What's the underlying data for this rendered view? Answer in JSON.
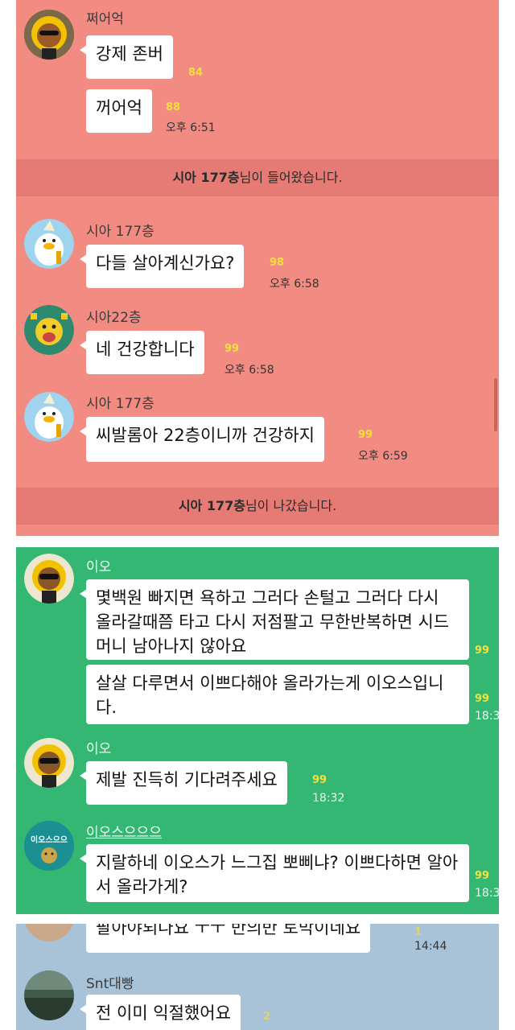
{
  "panel1": {
    "msg1": {
      "sender": "쩌어억",
      "bubbles": [
        {
          "text": "강제 존버",
          "unread": "84"
        },
        {
          "text": "꺼어억",
          "unread": "88",
          "time": "오후 6:51"
        }
      ]
    },
    "notice_join": {
      "name": "시아 177층",
      "suffix": "님이 들어왔습니다."
    },
    "msg2": {
      "sender": "시아 177층",
      "text": "다들 살아계신가요?",
      "unread": "98",
      "time": "오후 6:58"
    },
    "msg3": {
      "sender": "시아22층",
      "text": "네 건강합니다",
      "unread": "99",
      "time": "오후 6:58"
    },
    "msg4": {
      "sender": "시아 177층",
      "text": "씨발롬아 22층이니까 건강하지",
      "unread": "99",
      "time": "오후 6:59"
    },
    "notice_leave": {
      "name": "시아 177층",
      "suffix": "님이 나갔습니다."
    }
  },
  "panel2": {
    "msg1": {
      "sender": "이오",
      "bubble1": {
        "text": "몇백원 빠지면 욕하고 그러다 손털고 그러다 다시 올라갈때쯤 타고 다시 저점팔고 무한반복하면 시드머니 남아나지 않아요",
        "unread": "99"
      },
      "bubble2": {
        "text": "살살 다루면서 이쁘다해야 올라가는게 이오스입니다.",
        "unread": "99",
        "time": "18:3"
      }
    },
    "msg2": {
      "sender": "이오",
      "text": "제발 진득히 기다려주세요",
      "unread": "99",
      "time": "18:32"
    },
    "msg3": {
      "sender": "이오스으으으",
      "avatar_label": "이오스으으",
      "text": "지랄하네 이오스가 느그집 뽀삐냐? 이쁘다하면 알아서 올라가게?",
      "unread": "99",
      "time": "18:3"
    }
  },
  "panel3": {
    "msg1": {
      "text": "팔아야되나요 ㅜㅜ 반의반 토막이네요",
      "unread": "1",
      "time": "14:44"
    },
    "msg2": {
      "sender": "Snt대빵",
      "text": "전 이미 익절했어요",
      "unread": "2"
    }
  },
  "colors": {
    "panel1_bg": "#f28b82",
    "panel2_bg": "#34b772",
    "panel3_bg": "#a8c3d8",
    "unread": "#f4e03c"
  }
}
